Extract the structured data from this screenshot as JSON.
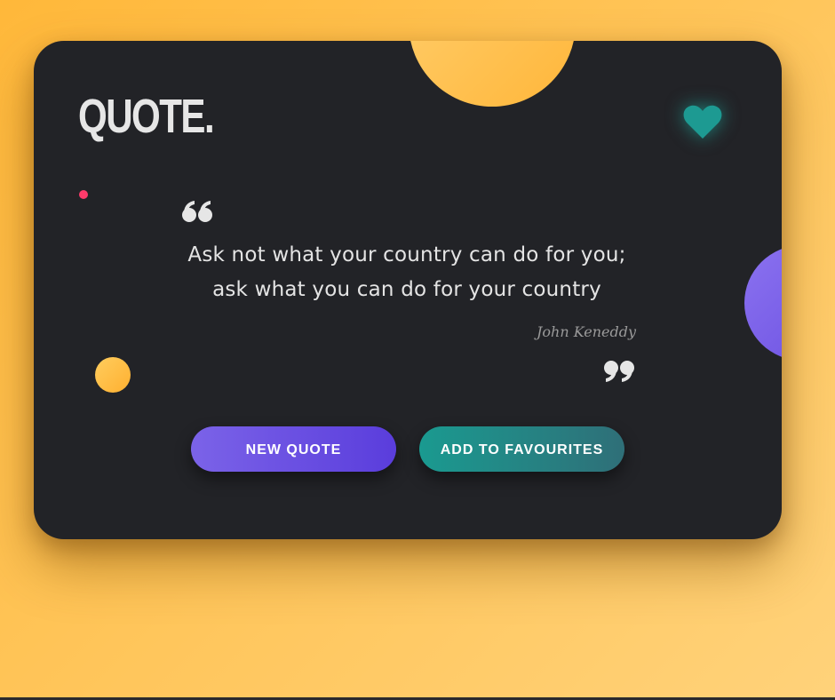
{
  "app": {
    "logo_text": "QUOTE."
  },
  "quote": {
    "text": "Ask not what your country can do for you; ask what you can do for your country",
    "author": "John Keneddy"
  },
  "actions": {
    "new_quote_label": "NEW QUOTE",
    "add_favourite_label": "ADD TO FAVOURITES"
  },
  "icons": {
    "favourite": "heart-icon",
    "open_quote": "open-quote-icon",
    "close_quote": "close-quote-icon"
  },
  "colors": {
    "background": "#ffc04e",
    "card": "#222327",
    "accent_purple": "#6a4fe0",
    "accent_teal": "#1a9a90",
    "accent_yellow": "#ffb63a",
    "accent_pink": "#ff3b6b",
    "text": "#e4e4e4",
    "author_text": "#9a9a9a"
  }
}
